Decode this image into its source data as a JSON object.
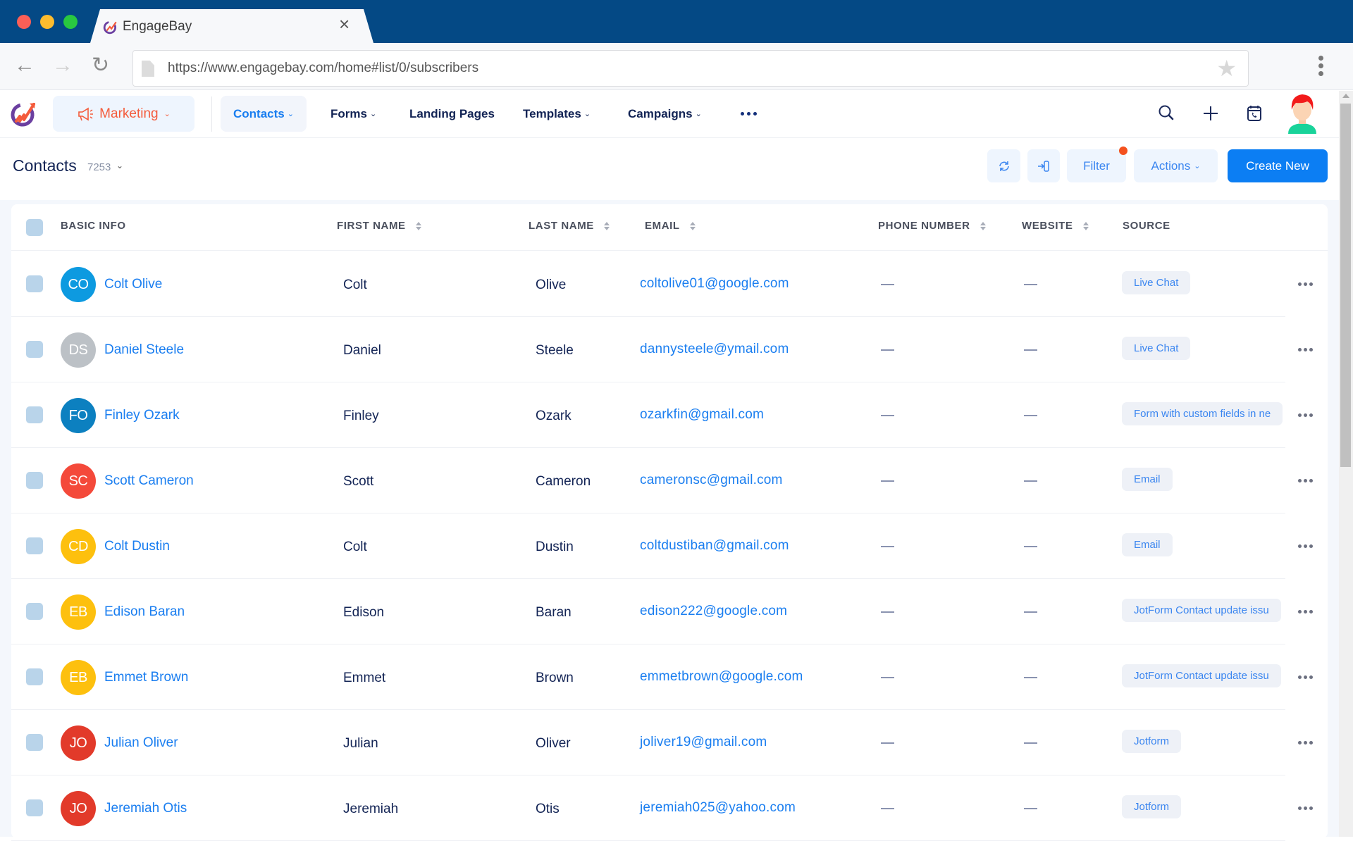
{
  "browser": {
    "tab_title": "EngageBay",
    "url": "https://www.engagebay.com/home#list/0/subscribers",
    "icons": [
      "back-icon",
      "forward-icon",
      "reload-icon",
      "page-icon",
      "star-icon",
      "menu-icon",
      "close-icon"
    ]
  },
  "app_nav": {
    "module": "Marketing",
    "items": [
      {
        "label": "Contacts",
        "dropdown": true,
        "active": true
      },
      {
        "label": "Forms",
        "dropdown": true
      },
      {
        "label": "Landing Pages",
        "dropdown": false
      },
      {
        "label": "Templates",
        "dropdown": true
      },
      {
        "label": "Campaigns",
        "dropdown": true
      }
    ],
    "right_icons": [
      "search-icon",
      "plus-icon",
      "call-calendar-icon",
      "user-avatar"
    ]
  },
  "page": {
    "title": "Contacts",
    "count": "7253",
    "buttons": {
      "refresh": "refresh-icon",
      "import": "import-icon",
      "filter": "Filter",
      "actions": "Actions",
      "create": "Create New"
    }
  },
  "table": {
    "headers": {
      "basic_info": "BASIC INFO",
      "first_name": "FIRST NAME",
      "last_name": "LAST NAME",
      "email": "EMAIL",
      "phone": "PHONE NUMBER",
      "website": "WEBSITE",
      "source": "SOURCE"
    },
    "rows": [
      {
        "initials": "CO",
        "avatar_color": "#0d9ae0",
        "name": "Colt Olive",
        "first": "Colt",
        "last": "Olive",
        "email": "coltolive01@google.com",
        "phone": "—",
        "website": "—",
        "source": "Live Chat"
      },
      {
        "initials": "DS",
        "avatar_color": "#bcc1c6",
        "name": "Daniel Steele",
        "first": "Daniel",
        "last": "Steele",
        "email": "dannysteele@ymail.com",
        "phone": "—",
        "website": "—",
        "source": "Live Chat"
      },
      {
        "initials": "FO",
        "avatar_color": "#0c80c0",
        "name": "Finley Ozark",
        "first": "Finley",
        "last": "Ozark",
        "email": "ozarkfin@gmail.com",
        "phone": "—",
        "website": "—",
        "source": "Form with custom fields in ne"
      },
      {
        "initials": "SC",
        "avatar_color": "#f4493a",
        "name": "Scott Cameron",
        "first": "Scott",
        "last": "Cameron",
        "email": "cameronsc@gmail.com",
        "phone": "—",
        "website": "—",
        "source": "Email"
      },
      {
        "initials": "CD",
        "avatar_color": "#fdc00e",
        "name": "Colt Dustin",
        "first": "Colt",
        "last": "Dustin",
        "email": "coltdustiban@gmail.com",
        "phone": "—",
        "website": "—",
        "source": "Email"
      },
      {
        "initials": "EB",
        "avatar_color": "#fdc00e",
        "name": "Edison Baran",
        "first": "Edison",
        "last": "Baran",
        "email": "edison222@google.com",
        "phone": "—",
        "website": "—",
        "source": "JotForm Contact update issu"
      },
      {
        "initials": "EB",
        "avatar_color": "#fdc00e",
        "name": "Emmet Brown",
        "first": "Emmet",
        "last": "Brown",
        "email": "emmetbrown@google.com",
        "phone": "—",
        "website": "—",
        "source": "JotForm Contact update issu"
      },
      {
        "initials": "JO",
        "avatar_color": "#e23a2a",
        "name": "Julian Oliver",
        "first": "Julian",
        "last": "Oliver",
        "email": "joliver19@gmail.com",
        "phone": "—",
        "website": "—",
        "source": "Jotform"
      },
      {
        "initials": "JO",
        "avatar_color": "#e23a2a",
        "name": "Jeremiah Otis",
        "first": "Jeremiah",
        "last": "Otis",
        "email": "jeremiah025@yahoo.com",
        "phone": "—",
        "website": "—",
        "source": "Jotform"
      }
    ]
  },
  "colors": {
    "browser_chrome": "#044985",
    "accent_blue": "#0c7ef3",
    "marketing_orange": "#f45b3c",
    "filter_badge": "#f4511e"
  }
}
